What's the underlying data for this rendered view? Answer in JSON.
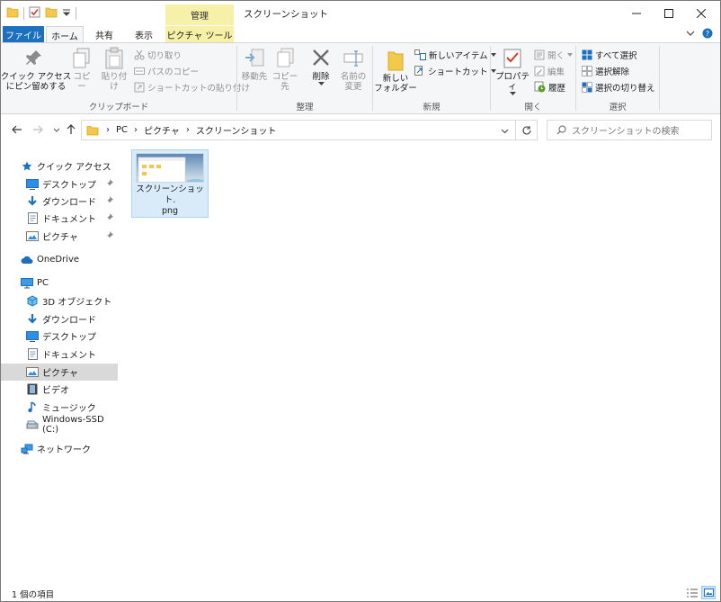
{
  "window": {
    "title": "スクリーンショット",
    "manage_tab": "管理",
    "controls": [
      "minimize-icon",
      "maximize-icon",
      "close-icon"
    ]
  },
  "quick_access_toolbar": [
    "folder-icon",
    "properties-check-icon",
    "new-folder-icon",
    "customize-dropdown-icon"
  ],
  "tabs": {
    "file": "ファイル",
    "home": "ホーム",
    "share": "共有",
    "view": "表示",
    "picture_tools": "ピクチャ ツール"
  },
  "ribbon": {
    "clipboard": {
      "pin_quick_access": "クイック アクセス\nにピン留めする",
      "copy": "コピー",
      "paste": "貼り付け",
      "cut": "切り取り",
      "copy_path": "パスのコピー",
      "paste_shortcut": "ショートカットの貼り付け",
      "group_label": "クリップボード"
    },
    "organize": {
      "move_to": "移動先",
      "copy_to": "コピー先",
      "delete": "削除",
      "rename": "名前の\n変更",
      "group_label": "整理"
    },
    "new": {
      "new_folder": "新しい\nフォルダー",
      "new_item": "新しいアイテム",
      "easy_access": "ショートカット",
      "group_label": "新規"
    },
    "open": {
      "properties": "プロパティ",
      "open": "開く",
      "edit": "編集",
      "history": "履歴",
      "group_label": "開く"
    },
    "select": {
      "select_all": "すべて選択",
      "select_none": "選択解除",
      "invert": "選択の切り替え",
      "group_label": "選択"
    }
  },
  "address": {
    "crumbs": [
      "PC",
      "ピクチャ",
      "スクリーンショット"
    ],
    "search_placeholder": "スクリーンショットの検索"
  },
  "nav_pane": {
    "quick_access": "クイック アクセス",
    "qa_items": [
      "デスクトップ",
      "ダウンロード",
      "ドキュメント",
      "ピクチャ"
    ],
    "onedrive": "OneDrive",
    "pc": "PC",
    "pc_items": [
      "3D オブジェクト",
      "ダウンロード",
      "デスクトップ",
      "ドキュメント",
      "ピクチャ",
      "ビデオ",
      "ミュージック",
      "Windows-SSD (C:)"
    ],
    "network": "ネットワーク",
    "selected": "ピクチャ"
  },
  "files": [
    {
      "name_line1": "スクリーンショット.",
      "name_line2": "png"
    }
  ],
  "status": {
    "item_count": "1 個の項目"
  },
  "colors": {
    "accent": "#1d6fbf",
    "picture_tools": "#f7f0a8",
    "selection": "#d9ebf9",
    "nav_selected": "#d9d9d9"
  }
}
